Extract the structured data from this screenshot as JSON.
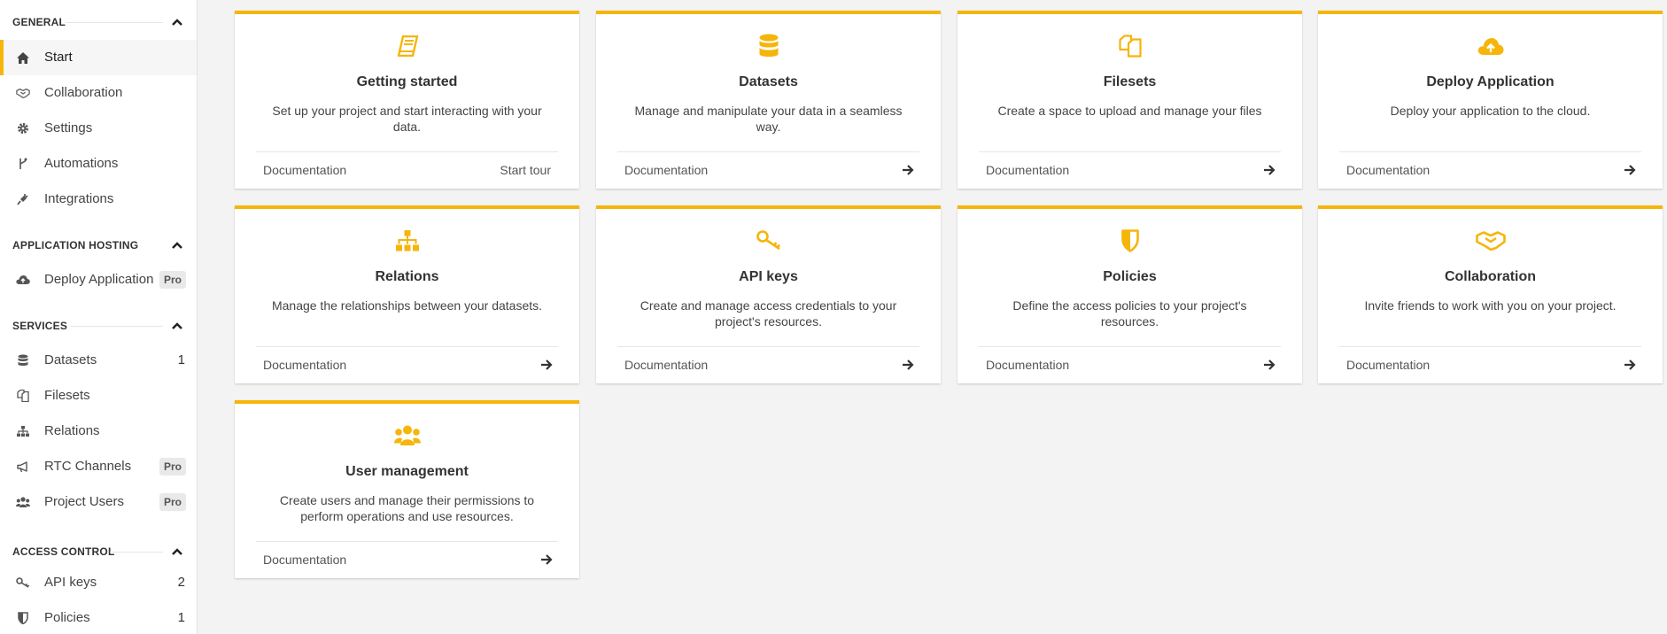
{
  "colors": {
    "accent": "#f5b50a",
    "background": "#f3f3f3",
    "sidebar_icon": "#555555"
  },
  "sidebar": {
    "sections": [
      {
        "title": "GENERAL",
        "chevron_icon": "chevron-up-icon"
      },
      {
        "title": "APPLICATION HOSTING",
        "chevron_icon": "chevron-up-icon"
      },
      {
        "title": "SERVICES",
        "chevron_icon": "chevron-up-icon"
      },
      {
        "title": "ACCESS CONTROL",
        "chevron_icon": "chevron-up-icon"
      }
    ],
    "items": [
      {
        "label": "Start",
        "icon": "home-icon",
        "active": true
      },
      {
        "label": "Collaboration",
        "icon": "handshake-icon"
      },
      {
        "label": "Settings",
        "icon": "gear-icon"
      },
      {
        "label": "Automations",
        "icon": "branch-icon"
      },
      {
        "label": "Integrations",
        "icon": "plug-icon"
      },
      {
        "label": "Deploy Application",
        "icon": "cloud-upload-icon",
        "badge": "Pro"
      },
      {
        "label": "Datasets",
        "icon": "database-icon",
        "count": "1"
      },
      {
        "label": "Filesets",
        "icon": "files-icon"
      },
      {
        "label": "Relations",
        "icon": "sitemap-icon"
      },
      {
        "label": "RTC Channels",
        "icon": "megaphone-icon",
        "badge": "Pro"
      },
      {
        "label": "Project Users",
        "icon": "users-icon",
        "badge": "Pro"
      },
      {
        "label": "API keys",
        "icon": "key-icon",
        "count": "2"
      },
      {
        "label": "Policies",
        "icon": "shield-icon",
        "count": "1"
      }
    ]
  },
  "cards": [
    {
      "title": "Getting started",
      "icon": "book-icon",
      "description": "Set up your project and start interacting with your data.",
      "doc_label": "Documentation",
      "action_label": "Start tour"
    },
    {
      "title": "Datasets",
      "icon": "database-icon",
      "description": "Manage and manipulate your data in a seamless way.",
      "doc_label": "Documentation"
    },
    {
      "title": "Filesets",
      "icon": "files-icon",
      "description": "Create a space to upload and manage your files",
      "doc_label": "Documentation"
    },
    {
      "title": "Deploy Application",
      "icon": "cloud-upload-icon",
      "description": "Deploy your application to the cloud.",
      "doc_label": "Documentation"
    },
    {
      "title": "Relations",
      "icon": "sitemap-icon",
      "description": "Manage the relationships between your datasets.",
      "doc_label": "Documentation"
    },
    {
      "title": "API keys",
      "icon": "key-icon",
      "description": "Create and manage access credentials to your project's resources.",
      "doc_label": "Documentation"
    },
    {
      "title": "Policies",
      "icon": "shield-icon",
      "description": "Define the access policies to your project's resources.",
      "doc_label": "Documentation"
    },
    {
      "title": "Collaboration",
      "icon": "handshake-icon",
      "description": "Invite friends to work with you on your project.",
      "doc_label": "Documentation"
    },
    {
      "title": "User management",
      "icon": "users-icon",
      "description": "Create users and manage their permissions to perform operations and use resources.",
      "doc_label": "Documentation"
    }
  ]
}
